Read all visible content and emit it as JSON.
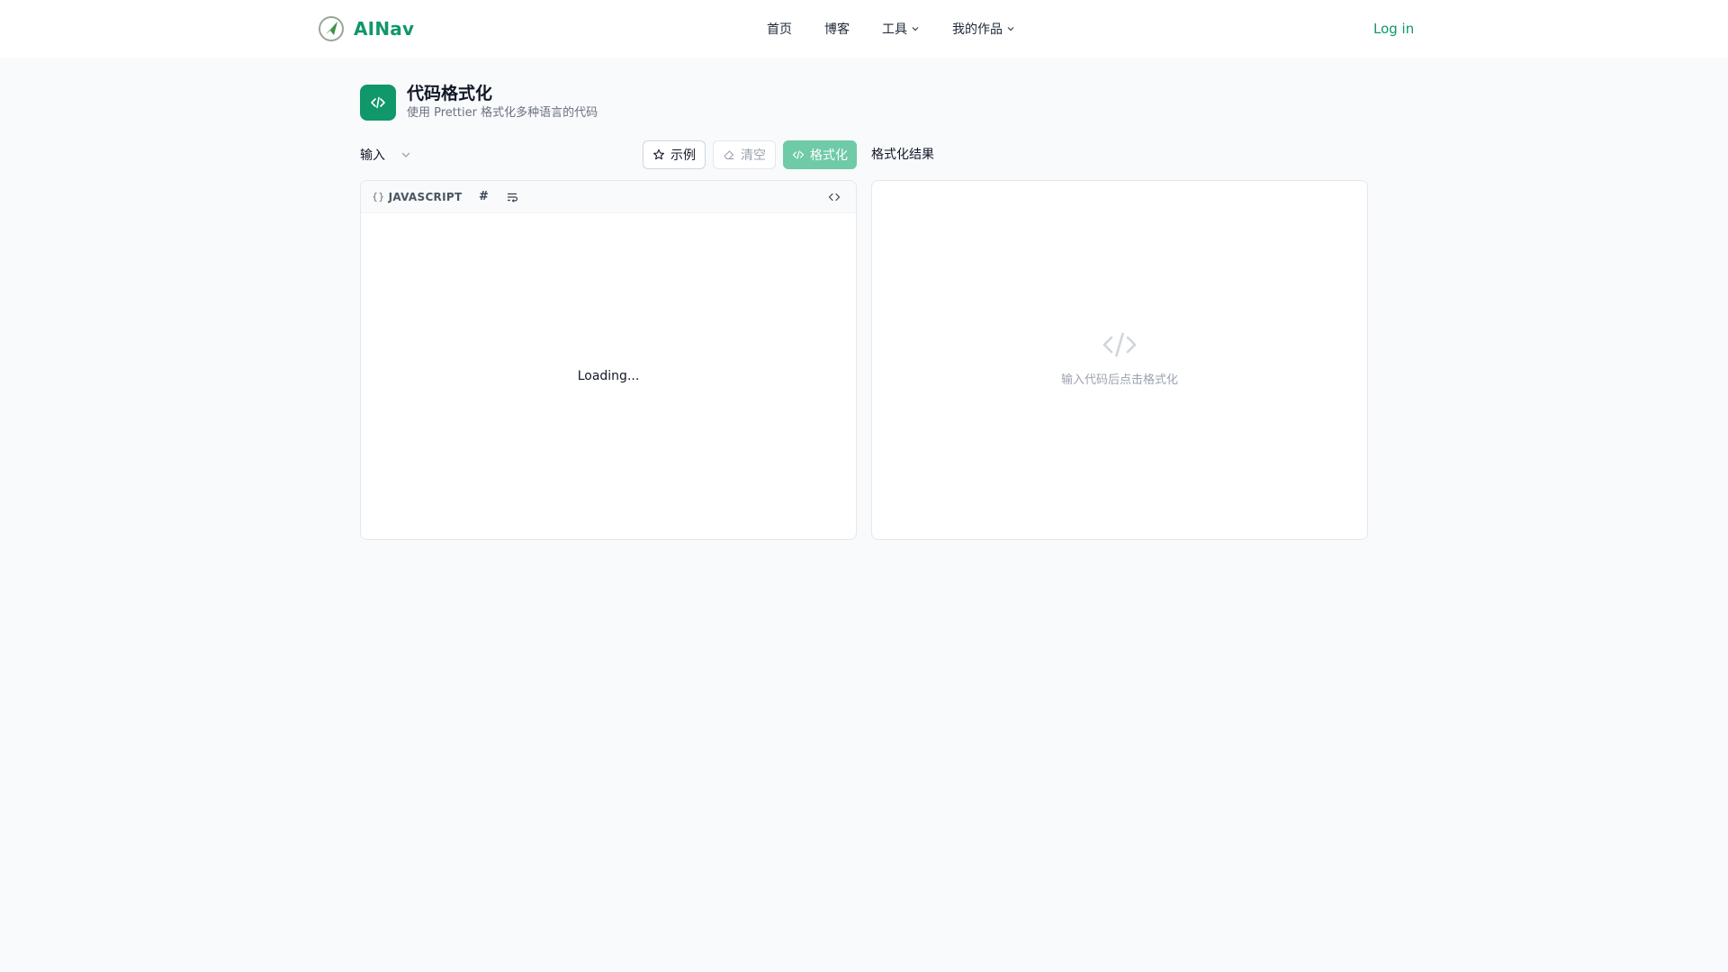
{
  "app": {
    "name": "AINav",
    "brand_color": "#10976a"
  },
  "nav": {
    "items": [
      {
        "label": "首页",
        "has_dropdown": false
      },
      {
        "label": "博客",
        "has_dropdown": false
      },
      {
        "label": "工具",
        "has_dropdown": true
      },
      {
        "label": "我的作品",
        "has_dropdown": true
      }
    ],
    "login_label": "Log in"
  },
  "tool": {
    "title": "代码格式化",
    "subtitle": "使用 Prettier 格式化多种语言的代码",
    "icon": "code-icon"
  },
  "toolbar": {
    "input_label": "输入",
    "example_label": "示例",
    "clear_label": "清空",
    "format_label": "格式化",
    "result_label": "格式化结果"
  },
  "editor": {
    "language": "JAVASCRIPT",
    "braces": "{}",
    "hash": "#",
    "loading_text": "Loading..."
  },
  "result": {
    "empty_text": "输入代码后点击格式化"
  },
  "colors": {
    "accent": "#10976a",
    "format_button": "#6fcaa7",
    "background": "#f8fafc"
  }
}
